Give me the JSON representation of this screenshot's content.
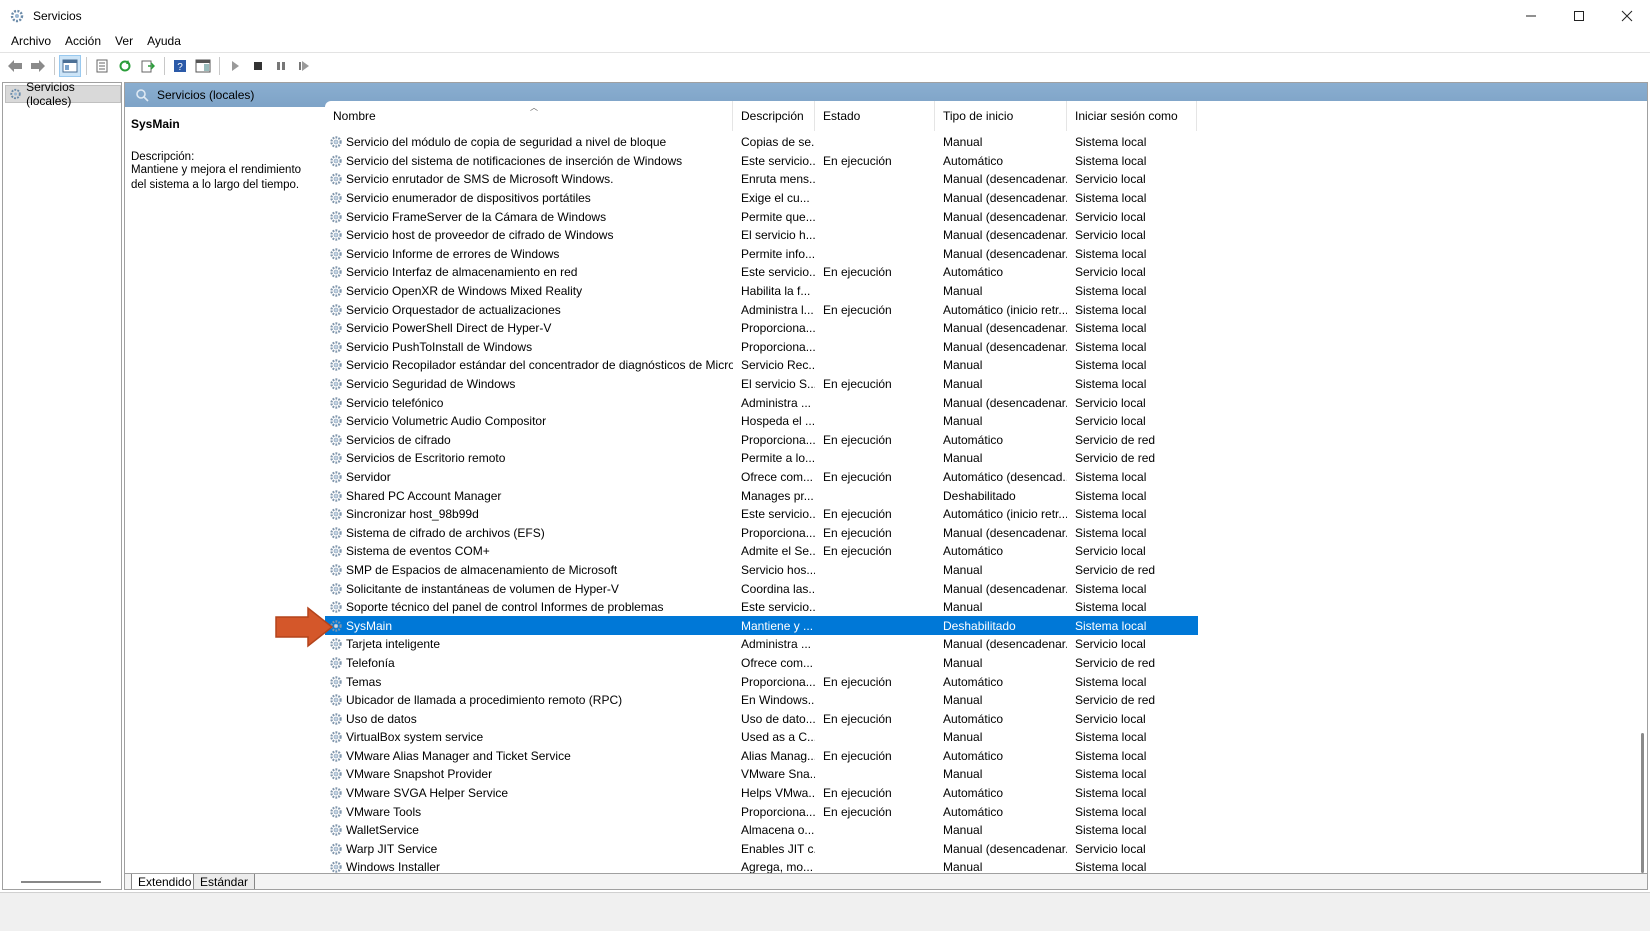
{
  "window": {
    "title": "Servicios"
  },
  "menu": [
    "Archivo",
    "Acción",
    "Ver",
    "Ayuda"
  ],
  "tree": {
    "item": "Servicios (locales)"
  },
  "panel": {
    "header": "Servicios (locales)"
  },
  "details": {
    "service_name": "SysMain",
    "description_label": "Descripción:",
    "description_text": "Mantiene y mejora el rendimiento del sistema a lo largo del tiempo."
  },
  "columns": [
    "Nombre",
    "Descripción",
    "Estado",
    "Tipo de inicio",
    "Iniciar sesión como"
  ],
  "rows": [
    {
      "name": "Servicio del módulo de copia de seguridad a nivel de bloque",
      "desc": "Copias de se...",
      "state": "",
      "start": "Manual",
      "logon": "Sistema local"
    },
    {
      "name": "Servicio del sistema de notificaciones de inserción de Windows",
      "desc": "Este servicio...",
      "state": "En ejecución",
      "start": "Automático",
      "logon": "Sistema local"
    },
    {
      "name": "Servicio enrutador de SMS de Microsoft Windows.",
      "desc": "Enruta mens...",
      "state": "",
      "start": "Manual (desencadenar...",
      "logon": "Servicio local"
    },
    {
      "name": "Servicio enumerador de dispositivos portátiles",
      "desc": "Exige el cu...",
      "state": "",
      "start": "Manual (desencadenar...",
      "logon": "Sistema local"
    },
    {
      "name": "Servicio FrameServer de la Cámara de Windows",
      "desc": "Permite que...",
      "state": "",
      "start": "Manual (desencadenar...",
      "logon": "Servicio local"
    },
    {
      "name": "Servicio host de proveedor de cifrado de Windows",
      "desc": "El servicio h...",
      "state": "",
      "start": "Manual (desencadenar...",
      "logon": "Servicio local"
    },
    {
      "name": "Servicio Informe de errores de Windows",
      "desc": "Permite info...",
      "state": "",
      "start": "Manual (desencadenar...",
      "logon": "Sistema local"
    },
    {
      "name": "Servicio Interfaz de almacenamiento en red",
      "desc": "Este servicio...",
      "state": "En ejecución",
      "start": "Automático",
      "logon": "Servicio local"
    },
    {
      "name": "Servicio OpenXR de Windows Mixed Reality",
      "desc": "Habilita la f...",
      "state": "",
      "start": "Manual",
      "logon": "Sistema local"
    },
    {
      "name": "Servicio Orquestador de actualizaciones",
      "desc": "Administra l...",
      "state": "En ejecución",
      "start": "Automático (inicio retr...",
      "logon": "Sistema local"
    },
    {
      "name": "Servicio PowerShell Direct de Hyper-V",
      "desc": "Proporciona...",
      "state": "",
      "start": "Manual (desencadenar...",
      "logon": "Sistema local"
    },
    {
      "name": "Servicio PushToInstall de Windows",
      "desc": "Proporciona...",
      "state": "",
      "start": "Manual (desencadenar...",
      "logon": "Sistema local"
    },
    {
      "name": "Servicio Recopilador estándar del concentrador de diagnósticos de Microsof...",
      "desc": "Servicio Rec...",
      "state": "",
      "start": "Manual",
      "logon": "Sistema local"
    },
    {
      "name": "Servicio Seguridad de Windows",
      "desc": "El servicio S...",
      "state": "En ejecución",
      "start": "Manual",
      "logon": "Sistema local"
    },
    {
      "name": "Servicio telefónico",
      "desc": "Administra ...",
      "state": "",
      "start": "Manual (desencadenar...",
      "logon": "Servicio local"
    },
    {
      "name": "Servicio Volumetric Audio Compositor",
      "desc": "Hospeda el ...",
      "state": "",
      "start": "Manual",
      "logon": "Servicio local"
    },
    {
      "name": "Servicios de cifrado",
      "desc": "Proporciona...",
      "state": "En ejecución",
      "start": "Automático",
      "logon": "Servicio de red"
    },
    {
      "name": "Servicios de Escritorio remoto",
      "desc": "Permite a lo...",
      "state": "",
      "start": "Manual",
      "logon": "Servicio de red"
    },
    {
      "name": "Servidor",
      "desc": "Ofrece com...",
      "state": "En ejecución",
      "start": "Automático (desencad...",
      "logon": "Sistema local"
    },
    {
      "name": "Shared PC Account Manager",
      "desc": "Manages pr...",
      "state": "",
      "start": "Deshabilitado",
      "logon": "Sistema local"
    },
    {
      "name": "Sincronizar host_98b99d",
      "desc": "Este servicio...",
      "state": "En ejecución",
      "start": "Automático (inicio retr...",
      "logon": "Sistema local"
    },
    {
      "name": "Sistema de cifrado de archivos (EFS)",
      "desc": "Proporciona...",
      "state": "En ejecución",
      "start": "Manual (desencadenar...",
      "logon": "Sistema local"
    },
    {
      "name": "Sistema de eventos COM+",
      "desc": "Admite el Se...",
      "state": "En ejecución",
      "start": "Automático",
      "logon": "Servicio local"
    },
    {
      "name": "SMP de Espacios de almacenamiento de Microsoft",
      "desc": "Servicio hos...",
      "state": "",
      "start": "Manual",
      "logon": "Servicio de red"
    },
    {
      "name": "Solicitante de instantáneas de volumen de Hyper-V",
      "desc": "Coordina las...",
      "state": "",
      "start": "Manual (desencadenar...",
      "logon": "Sistema local"
    },
    {
      "name": "Soporte técnico del panel de control Informes de problemas",
      "desc": "Este servicio...",
      "state": "",
      "start": "Manual",
      "logon": "Sistema local"
    },
    {
      "name": "SysMain",
      "desc": "Mantiene y ...",
      "state": "",
      "start": "Deshabilitado",
      "logon": "Sistema local",
      "selected": true
    },
    {
      "name": "Tarjeta inteligente",
      "desc": "Administra ...",
      "state": "",
      "start": "Manual (desencadenar...",
      "logon": "Servicio local"
    },
    {
      "name": "Telefonía",
      "desc": "Ofrece com...",
      "state": "",
      "start": "Manual",
      "logon": "Servicio de red"
    },
    {
      "name": "Temas",
      "desc": "Proporciona...",
      "state": "En ejecución",
      "start": "Automático",
      "logon": "Sistema local"
    },
    {
      "name": "Ubicador de llamada a procedimiento remoto (RPC)",
      "desc": "En Windows...",
      "state": "",
      "start": "Manual",
      "logon": "Servicio de red"
    },
    {
      "name": "Uso de datos",
      "desc": "Uso de dato...",
      "state": "En ejecución",
      "start": "Automático",
      "logon": "Servicio local"
    },
    {
      "name": "VirtualBox system service",
      "desc": "Used as a C...",
      "state": "",
      "start": "Manual",
      "logon": "Sistema local"
    },
    {
      "name": "VMware Alias Manager and Ticket Service",
      "desc": "Alias Manag...",
      "state": "En ejecución",
      "start": "Automático",
      "logon": "Sistema local"
    },
    {
      "name": "VMware Snapshot Provider",
      "desc": "VMware Sna...",
      "state": "",
      "start": "Manual",
      "logon": "Sistema local"
    },
    {
      "name": "VMware SVGA Helper Service",
      "desc": "Helps VMwa...",
      "state": "En ejecución",
      "start": "Automático",
      "logon": "Sistema local"
    },
    {
      "name": "VMware Tools",
      "desc": "Proporciona...",
      "state": "En ejecución",
      "start": "Automático",
      "logon": "Sistema local"
    },
    {
      "name": "WalletService",
      "desc": "Almacena o...",
      "state": "",
      "start": "Manual",
      "logon": "Sistema local"
    },
    {
      "name": "Warp JIT Service",
      "desc": "Enables JIT c...",
      "state": "",
      "start": "Manual (desencadenar...",
      "logon": "Servicio local"
    },
    {
      "name": "Windows Installer",
      "desc": "Agrega, mo...",
      "state": "",
      "start": "Manual",
      "logon": "Sistema local"
    }
  ],
  "tabs": [
    "Extendido",
    "Estándar"
  ],
  "colors": {
    "selection": "#0078d7",
    "header": "#7ea3c7",
    "arrow": "#d4572a"
  },
  "icons": [
    "services-icon",
    "back-icon",
    "forward-icon",
    "gear-icon",
    "play-icon",
    "stop-icon",
    "pause-icon",
    "restart-icon",
    "help-icon",
    "refresh-icon",
    "export-icon"
  ]
}
